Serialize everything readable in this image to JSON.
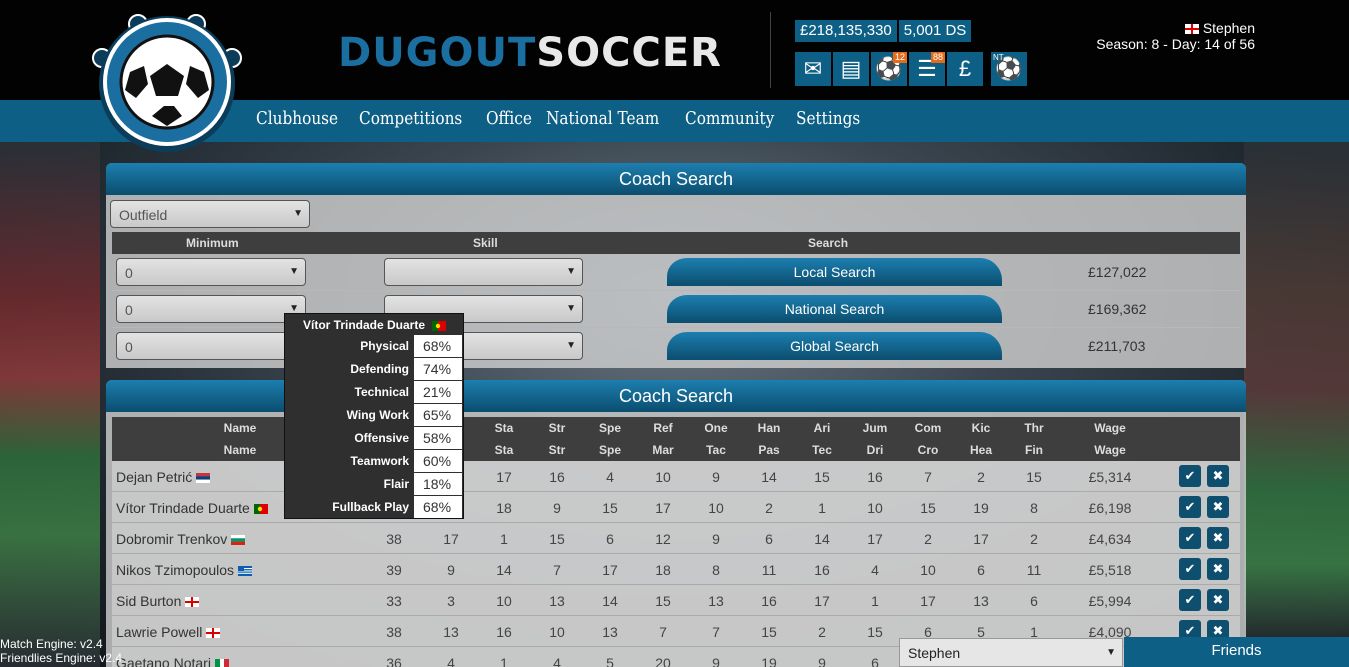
{
  "brand": {
    "part1": "DUGOUT",
    "part2": "SOCCER"
  },
  "balance": {
    "money": "£218,135,330",
    "ds": "5,001 DS"
  },
  "header_icons": [
    {
      "name": "mail-icon"
    },
    {
      "name": "news-icon"
    },
    {
      "name": "match-ball-icon",
      "badge": "12"
    },
    {
      "name": "list-icon",
      "badge": "88"
    },
    {
      "name": "finance-icon",
      "glyph": "£"
    },
    {
      "name": "national-team-icon",
      "label": "NT"
    }
  ],
  "user": {
    "name": "Stephen",
    "season": "Season: 8 - Day: 14 of 56"
  },
  "nav": [
    "Clubhouse",
    "Competitions",
    "Office",
    "National Team",
    "Community",
    "Settings"
  ],
  "search_panel": {
    "title": "Coach Search",
    "type_select": "Outfield",
    "col_minimum": "Minimum",
    "col_skill": "Skill",
    "col_search": "Search",
    "rows": [
      {
        "min": "0",
        "skill": "",
        "button": "Local Search",
        "cost": "£127,022"
      },
      {
        "min": "0",
        "skill": "",
        "button": "National Search",
        "cost": "£169,362"
      },
      {
        "min": "0",
        "skill": "",
        "button": "Global Search",
        "cost": "£211,703"
      }
    ]
  },
  "results_panel": {
    "title": "Coach Search",
    "header_row1": [
      "Name",
      "Sta",
      "Str",
      "Spe",
      "Ref",
      "One",
      "Han",
      "Ari",
      "Jum",
      "Com",
      "Kic",
      "Thr",
      "Wage"
    ],
    "header_row2": [
      "Name",
      "Sta",
      "Str",
      "Spe",
      "Mar",
      "Tac",
      "Pas",
      "Tec",
      "Dri",
      "Cro",
      "Hea",
      "Fin",
      "Wage"
    ],
    "rows": [
      {
        "name": "Dejan Petrić",
        "c1": "",
        "c2": "",
        "vals": [
          "17",
          "16",
          "4",
          "10",
          "9",
          "14",
          "15",
          "16",
          "7",
          "2",
          "15"
        ],
        "wage": "£5,314"
      },
      {
        "name": "Vítor Trindade Duarte",
        "c1": "",
        "c2": "",
        "vals": [
          "18",
          "9",
          "15",
          "17",
          "10",
          "2",
          "1",
          "10",
          "15",
          "19",
          "8"
        ],
        "wage": "£6,198"
      },
      {
        "name": "Dobromir Trenkov",
        "c1": "38",
        "c2": "17",
        "vals": [
          "1",
          "15",
          "6",
          "12",
          "9",
          "6",
          "14",
          "17",
          "2",
          "17",
          "2"
        ],
        "wage": "£4,634"
      },
      {
        "name": "Nikos Tzimopoulos",
        "c1": "39",
        "c2": "9",
        "vals": [
          "14",
          "7",
          "17",
          "18",
          "8",
          "11",
          "16",
          "4",
          "10",
          "6",
          "11"
        ],
        "wage": "£5,518"
      },
      {
        "name": "Sid Burton",
        "c1": "33",
        "c2": "3",
        "vals": [
          "10",
          "13",
          "14",
          "15",
          "13",
          "16",
          "17",
          "1",
          "17",
          "13",
          "6"
        ],
        "wage": "£5,994"
      },
      {
        "name": "Lawrie Powell",
        "c1": "38",
        "c2": "13",
        "vals": [
          "16",
          "10",
          "13",
          "7",
          "7",
          "15",
          "2",
          "15",
          "6",
          "5",
          "1"
        ],
        "wage": "£4,090"
      },
      {
        "name": "Gaetano Notari",
        "c1": "36",
        "c2": "4",
        "vals": [
          "1",
          "4",
          "5",
          "20",
          "9",
          "19",
          "9",
          "6",
          "",
          "",
          ""
        ],
        "wage": ""
      }
    ]
  },
  "tooltip": {
    "title": "Vítor Trindade Duarte",
    "items": [
      {
        "label": "Physical",
        "value": "68%"
      },
      {
        "label": "Defending",
        "value": "74%"
      },
      {
        "label": "Technical",
        "value": "21%"
      },
      {
        "label": "Wing Work",
        "value": "65%"
      },
      {
        "label": "Offensive",
        "value": "58%"
      },
      {
        "label": "Teamwork",
        "value": "60%"
      },
      {
        "label": "Flair",
        "value": "18%"
      },
      {
        "label": "Fullback Play",
        "value": "68%"
      }
    ]
  },
  "footer": {
    "match_engine": "Match Engine: v2.4",
    "friendlies_engine": "Friendlies Engine: v2.4",
    "user_select": "Stephen",
    "friends": "Friends"
  }
}
